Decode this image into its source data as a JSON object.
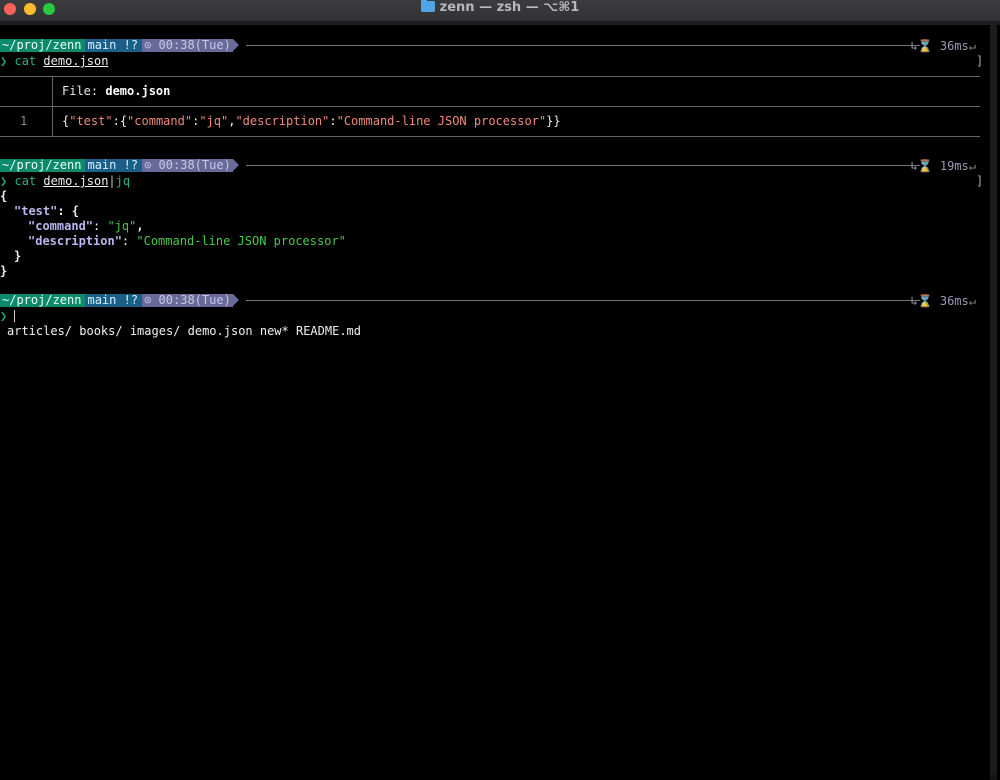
{
  "window": {
    "title": "zenn — zsh — ⌥⌘1"
  },
  "prompts": [
    {
      "path": "~/proj/zenn",
      "branch_icon": "",
      "branch": "main",
      "status": "!?",
      "clock_icon": "⊙",
      "time": "00:38(Tue)",
      "hourglass": "↳⌛",
      "duration": "36ms",
      "return_glyph": "↵"
    },
    {
      "path": "~/proj/zenn",
      "branch_icon": "",
      "branch": "main",
      "status": "!?",
      "clock_icon": "⊙",
      "time": "00:38(Tue)",
      "hourglass": "↳⌛",
      "duration": "19ms",
      "return_glyph": "↵"
    },
    {
      "path": "~/proj/zenn",
      "branch_icon": "",
      "branch": "main",
      "status": "!?",
      "clock_icon": "⊙",
      "time": "00:38(Tue)",
      "hourglass": "↳⌛",
      "duration": "36ms",
      "return_glyph": "↵"
    }
  ],
  "commands": [
    {
      "chevron": "❯",
      "cmd": "cat",
      "file": "demo.json",
      "pipe": "",
      "pipe_cmd": ""
    },
    {
      "chevron": "❯",
      "cmd": "cat",
      "file": "demo.json",
      "pipe": "|",
      "pipe_cmd": "jq"
    },
    {
      "chevron": "❯"
    }
  ],
  "bat": {
    "file_label": "File:",
    "file_name": "demo.json",
    "line_number": "1",
    "content_parts": [
      {
        "t": "{",
        "c": "br"
      },
      {
        "t": "\"test\"",
        "c": "s2"
      },
      {
        "t": ":{",
        "c": "br"
      },
      {
        "t": "\"command\"",
        "c": "s2"
      },
      {
        "t": ":",
        "c": "br"
      },
      {
        "t": "\"jq\"",
        "c": "s2"
      },
      {
        "t": ",",
        "c": "br"
      },
      {
        "t": "\"description\"",
        "c": "s2"
      },
      {
        "t": ":",
        "c": "br"
      },
      {
        "t": "\"Command-line JSON processor\"",
        "c": "s2"
      },
      {
        "t": "}}",
        "c": "br"
      }
    ]
  },
  "jq_output": {
    "open": "{",
    "test_key": "\"test\"",
    "test_colon": ": {",
    "command_key": "\"command\"",
    "command_colon": ": ",
    "command_val": "\"jq\"",
    "comma": ",",
    "desc_key": "\"description\"",
    "desc_colon": ": ",
    "desc_val": "\"Command-line JSON processor\"",
    "inner_close": "}",
    "outer_close": "}"
  },
  "ls_line": "articles/ books/ images/ demo.json new* README.md",
  "right_bracket": "]",
  "colors": {
    "path_bg": "#0d8a6a",
    "git_bg": "#1c5f86",
    "time_bg": "#6a6a9a",
    "prompt_green": "#28b483",
    "json_key": "#b8b8f0",
    "json_string": "#46c84d",
    "bat_string": "#f08a7a"
  }
}
